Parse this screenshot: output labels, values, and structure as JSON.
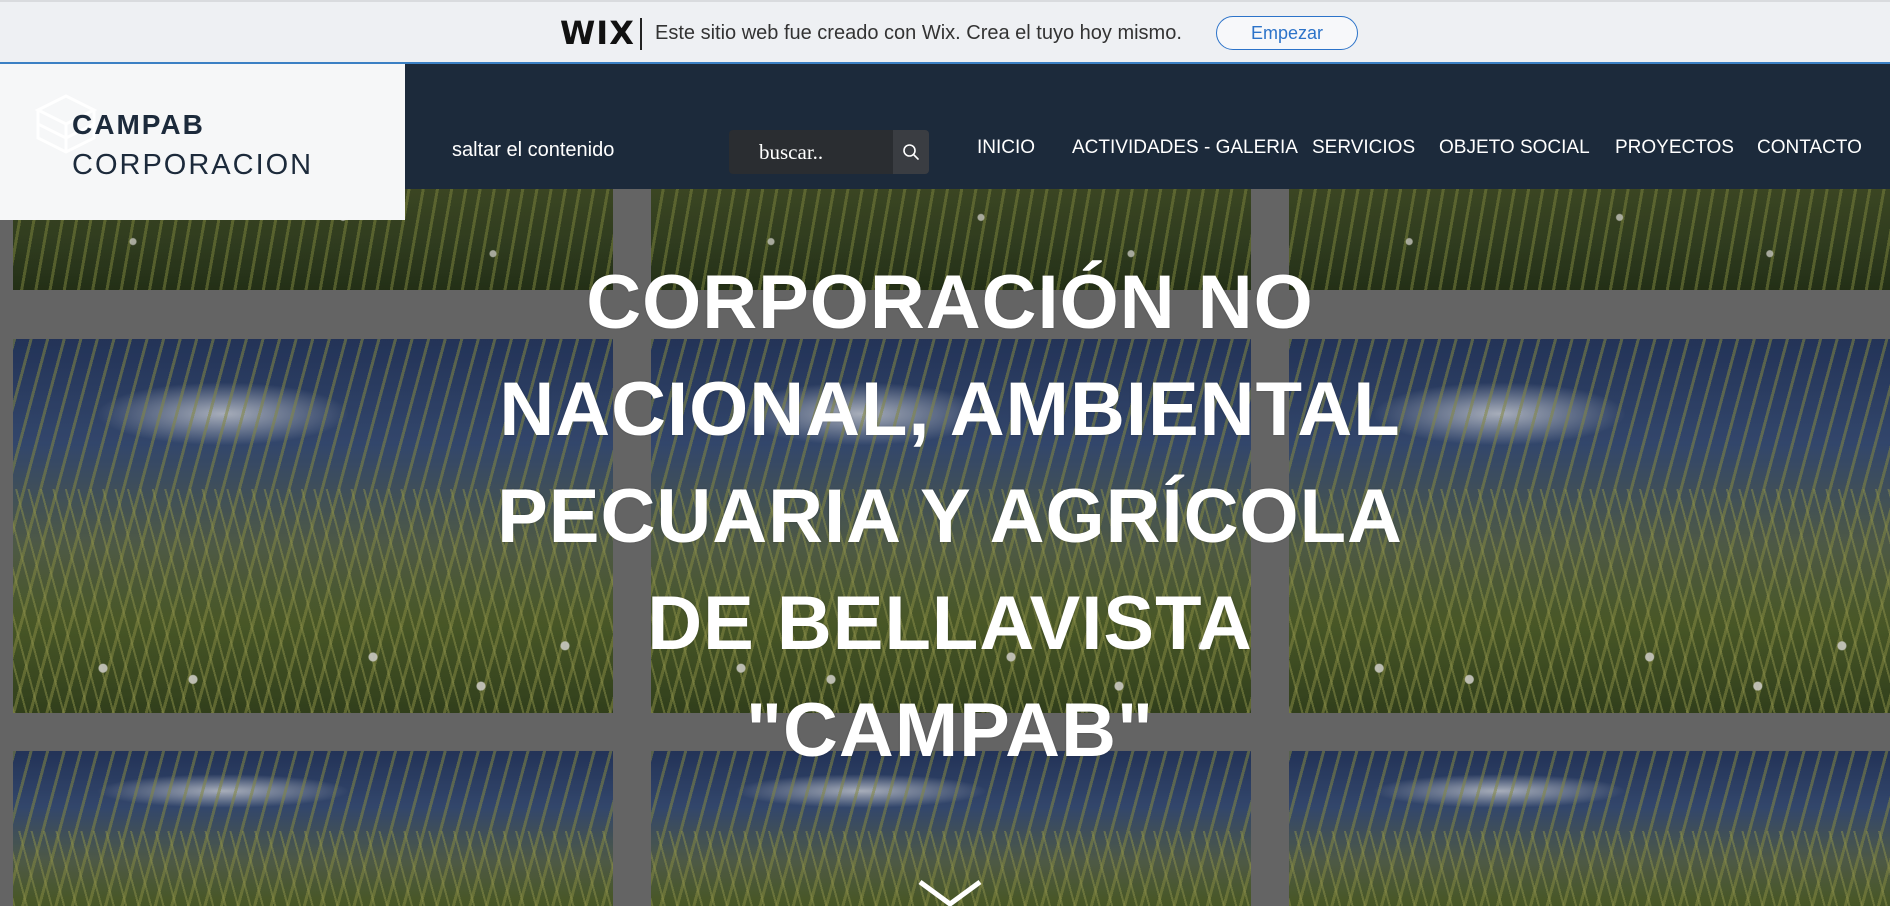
{
  "wix_banner": {
    "logo": "WIX",
    "message": "Este sitio web fue creado con Wix. Crea el tuyo hoy mismo.",
    "cta_label": "Empezar",
    "accent_color": "#2c73c9"
  },
  "header": {
    "logo_line1": "CAMPAB",
    "logo_line2": "CORPORACION",
    "skip_link": "saltar el contenido",
    "search_placeholder": "buscar..",
    "background_color": "#1c2a3b",
    "nav": [
      {
        "label": "INICIO"
      },
      {
        "label": "ACTIVIDADES - GALERIA"
      },
      {
        "label": "SERVICIOS"
      },
      {
        "label": "OBJETO SOCIAL"
      },
      {
        "label": "PROYECTOS"
      },
      {
        "label": "CONTACTO"
      }
    ]
  },
  "hero": {
    "title_lines": [
      "CORPORACIÓN NO",
      "NACIONAL, AMBIENTAL",
      "PECUARIA Y AGRÍCOLA",
      "DE BELLAVISTA",
      "\"CAMPAB\""
    ]
  },
  "icons": {
    "search": "search-icon",
    "scroll_down": "chevron-down-icon",
    "logo_mark": "cube-logo-icon"
  }
}
